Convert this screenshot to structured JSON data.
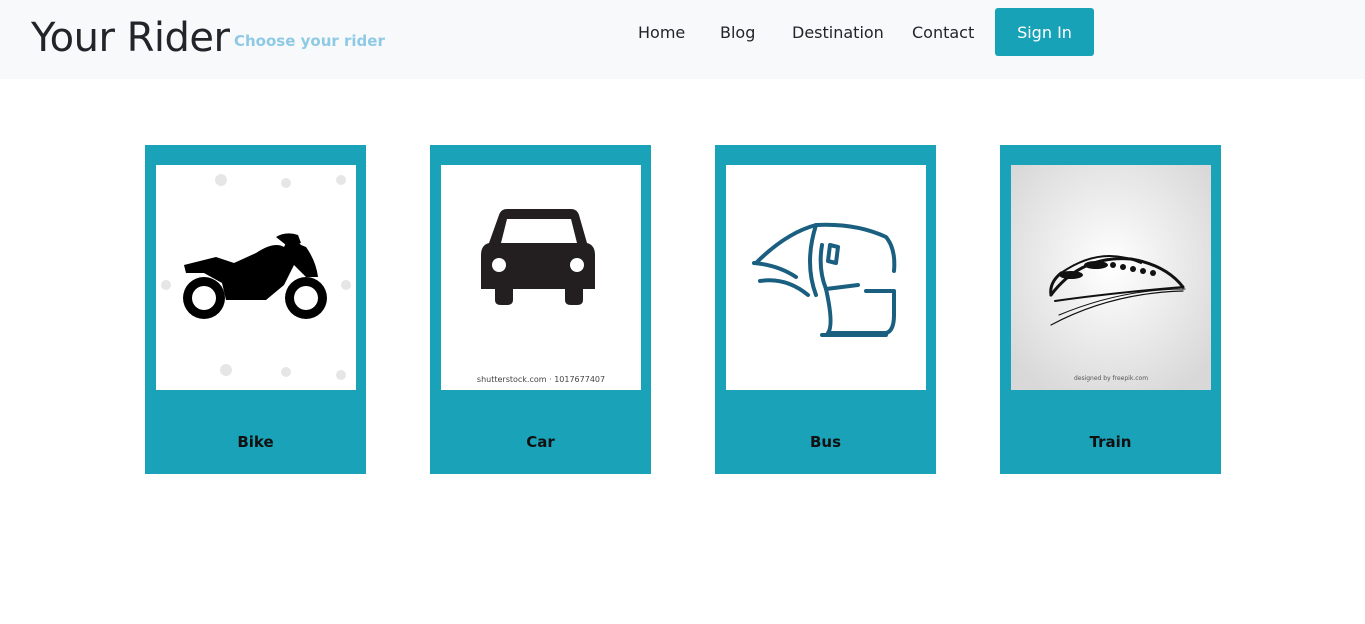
{
  "navbar": {
    "brand": "Your Rider",
    "tagline": "Choose your rider",
    "links": [
      "Home",
      "Blog",
      "Destination",
      "Contact"
    ],
    "signin_label": "Sign In",
    "accent_color": "#17a2b8"
  },
  "cards": [
    {
      "title": "Bike",
      "icon": "motorcycle-icon"
    },
    {
      "title": "Car",
      "icon": "car-icon",
      "image_caption": "shutterstock.com · 1017677407"
    },
    {
      "title": "Bus",
      "icon": "bus-icon"
    },
    {
      "title": "Train",
      "icon": "train-icon",
      "image_caption": "designed by freepik.com"
    }
  ]
}
